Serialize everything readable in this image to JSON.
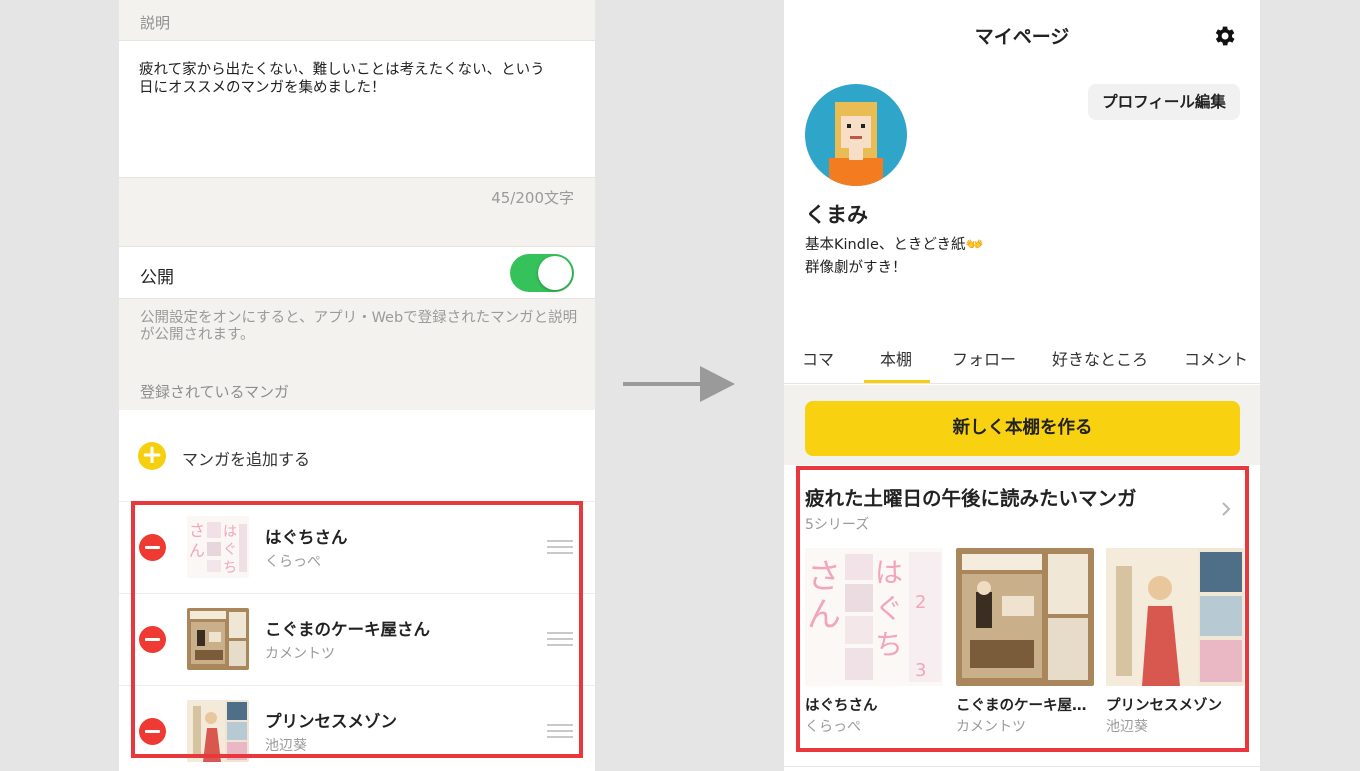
{
  "left": {
    "description_header": "説明",
    "description_text": "疲れて家から出たくない、難しいことは考えたくない、という\n日にオススメのマンガを集めました！",
    "char_counter": "45/200文字",
    "public_label": "公開",
    "public_on": true,
    "public_note": "公開設定をオンにすると、アプリ・Webで登録されたマンガと説明が公開されます。",
    "registered_header": "登録されているマンガ",
    "add_manga_label": "マンガを追加する",
    "manga": [
      {
        "title": "はぐちさん",
        "author": "くらっぺ"
      },
      {
        "title": "こぐまのケーキ屋さん",
        "author": "カメントツ"
      },
      {
        "title": "プリンセスメゾン",
        "author": "池辺葵"
      }
    ]
  },
  "right": {
    "title": "マイページ",
    "edit_profile": "プロフィール編集",
    "user_name": "くまみ",
    "bio": "基本Kindle、ときどき紙👐\n群像劇がすき！",
    "tabs": [
      "コマ",
      "本棚",
      "フォロー",
      "好きなところ",
      "コメント"
    ],
    "active_tab": "本棚",
    "new_shelf_button": "新しく本棚を作る",
    "shelf": {
      "title": "疲れた土曜日の午後に読みたいマンガ",
      "count": "5シリーズ",
      "books": [
        {
          "title": "はぐちさん",
          "author": "くらっぺ"
        },
        {
          "title": "こぐまのケーキ屋…",
          "author": "カメントツ"
        },
        {
          "title": "プリンセスメゾン",
          "author": "池辺葵"
        }
      ]
    }
  },
  "colors": {
    "accent_yellow": "#f8d110",
    "toggle_green": "#36c25a",
    "delete_red": "#ee3a33",
    "highlight_red": "#e8383d"
  }
}
